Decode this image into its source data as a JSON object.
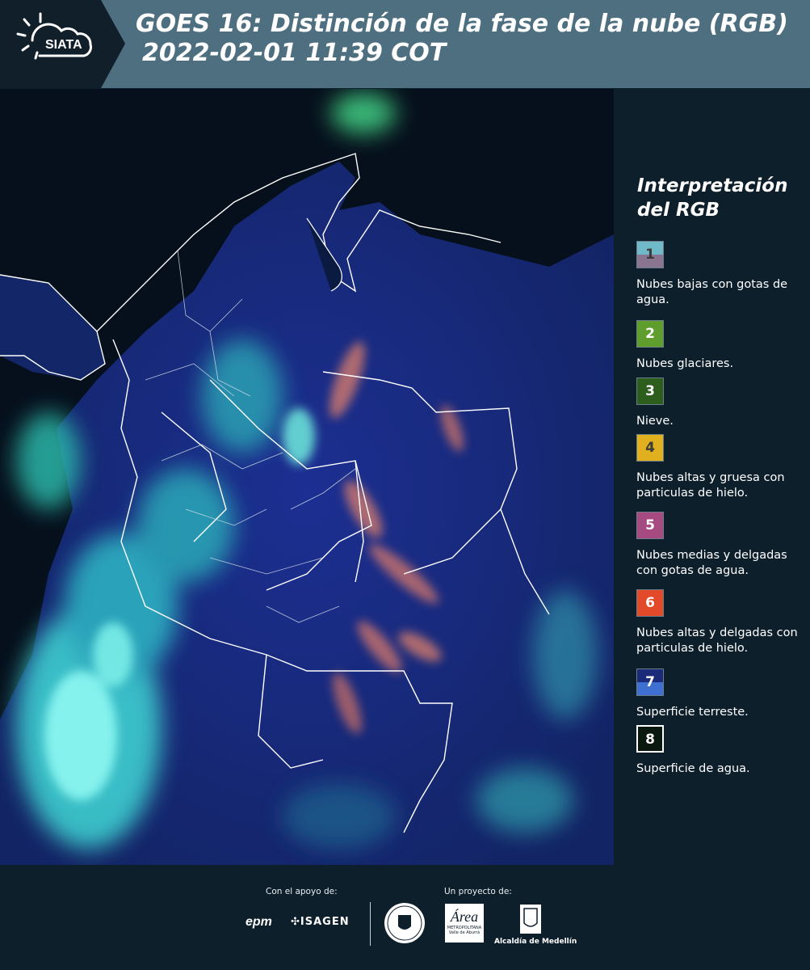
{
  "header": {
    "logo_text": "SIATA",
    "title_line1": "GOES 16: Distinción de la fase de la nube (RGB)",
    "title_line2": "2022-02-01 11:39 COT"
  },
  "map": {
    "description_colors": {
      "ocean": "#06101c",
      "land": "#1a2f8a",
      "cloud_cyan": "#3fe0d8",
      "ice_orange": "#e0806a"
    }
  },
  "legend": {
    "title_line1": "Interpretación",
    "title_line2": "del RGB",
    "items": [
      {
        "number": "1",
        "label": "Nubes bajas con gotas de agua.",
        "color_top": "#6fb9c9",
        "color_bottom": "#8a7591"
      },
      {
        "number": "2",
        "label": "Nubes glaciares.",
        "color_top": "#5f9e2c",
        "color_bottom": "#5f9e2c"
      },
      {
        "number": "3",
        "label": "Nieve.",
        "color_top": "#2e5e1e",
        "color_bottom": "#2e5e1e"
      },
      {
        "number": "4",
        "label": "Nubes altas y gruesa con particulas de hielo.",
        "color_top": "#e0b01e",
        "color_bottom": "#e0b01e"
      },
      {
        "number": "5",
        "label": "Nubes medias y delgadas con gotas de agua.",
        "color_top": "#a84a82",
        "color_bottom": "#a84a82"
      },
      {
        "number": "6",
        "label": "Nubes altas y delgadas con particulas de hielo.",
        "color_top": "#e24a2a",
        "color_bottom": "#e24a2a"
      },
      {
        "number": "7",
        "label": "Superficie terreste.",
        "color_top": "#1a2a78",
        "color_bottom": "#3f6fd0"
      },
      {
        "number": "8",
        "label": "Superficie de agua.",
        "color_top": "#0a1810",
        "color_bottom": "#0a1810"
      }
    ]
  },
  "footer": {
    "support_label": "Con el apoyo de:",
    "project_label": "Un proyecto de:",
    "sponsors": [
      "epm",
      "ISAGEN"
    ],
    "partners": [
      "Área Metropolitana Valle de Aburrá",
      "Alcaldía de Medellín"
    ],
    "area_text": "Área",
    "area_sub1": "METROPOLITANA",
    "area_sub2": "Valle de Aburrá",
    "alcaldia_text": "Alcaldía de Medellín"
  }
}
